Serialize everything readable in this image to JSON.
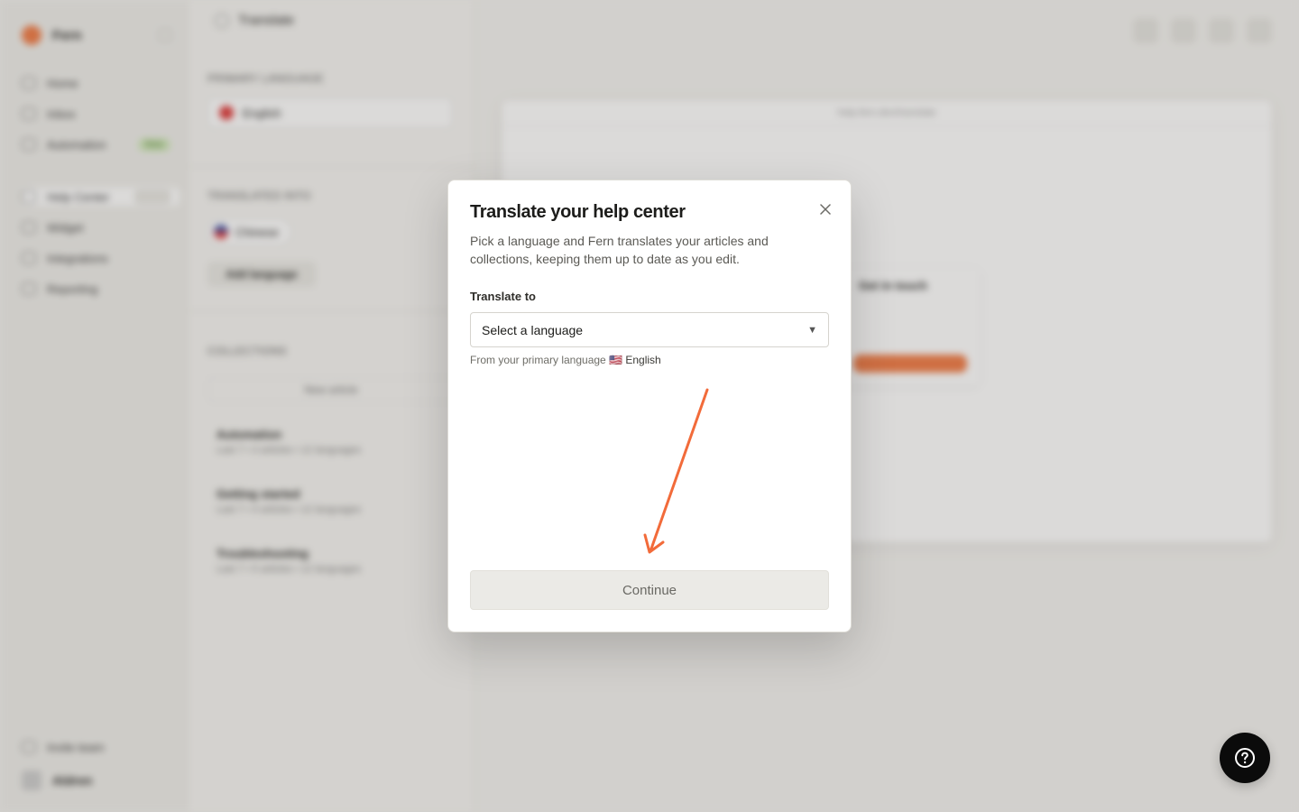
{
  "background": {
    "brand_name": "Fern",
    "nav_top": [
      {
        "label": "Home"
      },
      {
        "label": "Inbox"
      },
      {
        "label": "Automation",
        "badge": "New"
      }
    ],
    "nav_mid": [
      {
        "label": "Help Center"
      },
      {
        "label": "Widget"
      },
      {
        "label": "Integrations"
      },
      {
        "label": "Reporting"
      }
    ],
    "nav_bottom": [
      {
        "label": "Invite team"
      }
    ],
    "user_name": "Aldren",
    "settings_title": "Translate",
    "primary_language_label": "PRIMARY LANGUAGE",
    "primary_language_value": "English",
    "translated_label": "TRANSLATED INTO",
    "translated_chip": "Chinese",
    "add_language_button": "Add language",
    "collections_label": "COLLECTIONS",
    "new_collection_button": "New article",
    "collections": [
      {
        "name": "Automation",
        "meta": "Last 7 • 3 articles • 12 languages"
      },
      {
        "name": "Getting started",
        "meta": "Last 7 • 4 articles • 12 languages"
      },
      {
        "name": "Troubleshooting",
        "meta": "Last 7 • 5 articles • 12 languages"
      }
    ],
    "preview_bar": "help.fern.dev/translate",
    "preview_card_title": "Get in touch"
  },
  "modal": {
    "title": "Translate your help center",
    "description": "Pick a language and Fern translates your articles and collections, keeping them up to date as you edit.",
    "field_label": "Translate to",
    "select_placeholder": "Select a language",
    "select_arrow": "▼",
    "hint_prefix": "From your primary language",
    "hint_flag": "🇺🇸",
    "hint_language": "English",
    "continue_label": "Continue"
  },
  "colors": {
    "accent": "#f26b3a",
    "fab": "#0b0b0b"
  },
  "icons": {
    "close": "close-icon",
    "help": "help-circle-icon",
    "arrow": "annotation-arrow-icon"
  }
}
